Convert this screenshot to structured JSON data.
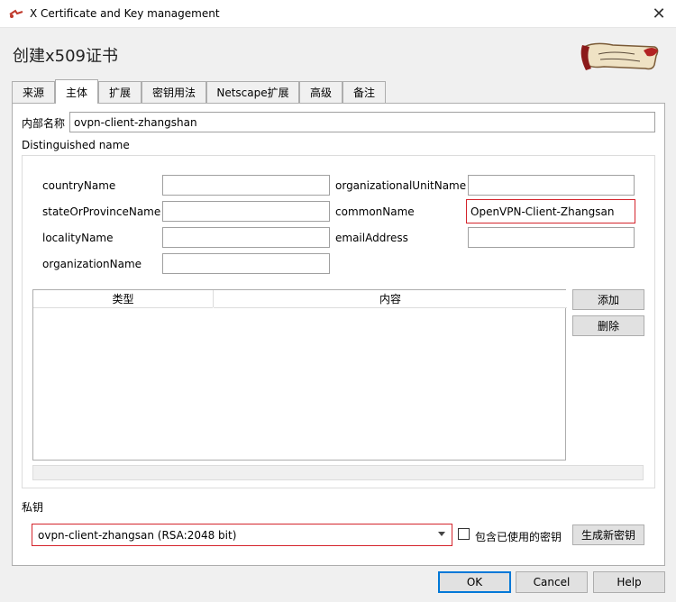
{
  "window": {
    "title": "X Certificate and Key management",
    "close_glyph": "✕"
  },
  "header": {
    "heading": "创建x509证书",
    "logo_icon": "xca-scroll-logo"
  },
  "tabs": [
    {
      "label": "来源",
      "active": false
    },
    {
      "label": "主体",
      "active": true
    },
    {
      "label": "扩展",
      "active": false
    },
    {
      "label": "密钥用法",
      "active": false
    },
    {
      "label": "Netscape扩展",
      "active": false
    },
    {
      "label": "高级",
      "active": false
    },
    {
      "label": "备注",
      "active": false
    }
  ],
  "subject": {
    "internal_name_label": "内部名称",
    "internal_name_value": "ovpn-client-zhangshan",
    "dn_group_label": "Distinguished name",
    "fields": {
      "countryName": {
        "label": "countryName",
        "value": ""
      },
      "stateOrProvinceName": {
        "label": "stateOrProvinceName",
        "value": ""
      },
      "localityName": {
        "label": "localityName",
        "value": ""
      },
      "organizationName": {
        "label": "organizationName",
        "value": ""
      },
      "organizationalUnitName": {
        "label": "organizationalUnitName",
        "value": ""
      },
      "commonName": {
        "label": "commonName",
        "value": "OpenVPN-Client-Zhangsan"
      },
      "emailAddress": {
        "label": "emailAddress",
        "value": ""
      }
    },
    "table": {
      "columns": [
        "类型",
        "内容"
      ],
      "rows": []
    },
    "add_button": "添加",
    "delete_button": "删除"
  },
  "private_key": {
    "label": "私钥",
    "selected": "ovpn-client-zhangsan (RSA:2048 bit)",
    "include_used_label": "包含已使用的密钥",
    "include_used_checked": false,
    "generate_button": "生成新密钥"
  },
  "footer": {
    "ok": "OK",
    "cancel": "Cancel",
    "help": "Help"
  },
  "colors": {
    "highlight_border": "#d4242c",
    "default_button_border": "#0078d7"
  }
}
